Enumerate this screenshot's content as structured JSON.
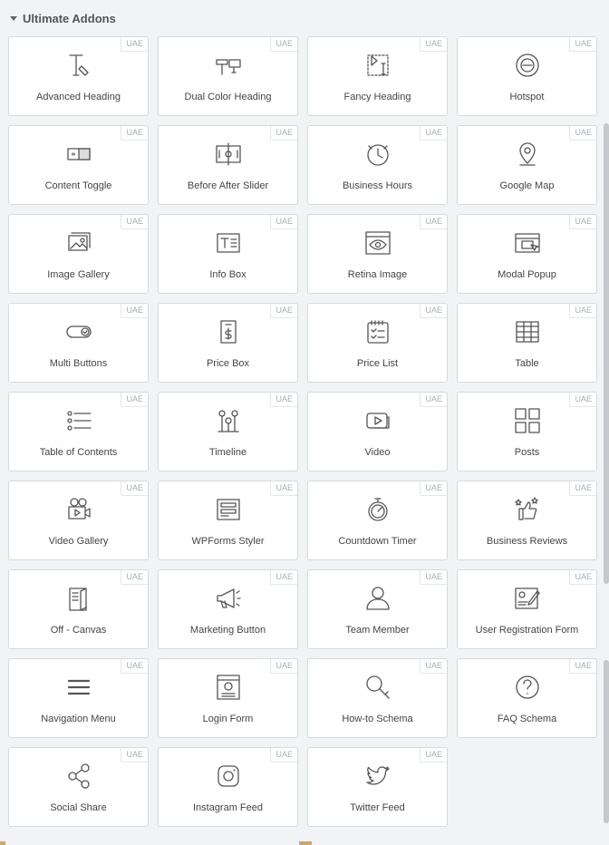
{
  "section": {
    "title": "Ultimate Addons"
  },
  "badge": "UAE",
  "widgets": [
    {
      "label": "Advanced Heading",
      "icon": "advanced-heading-icon"
    },
    {
      "label": "Dual Color Heading",
      "icon": "dual-color-heading-icon"
    },
    {
      "label": "Fancy Heading",
      "icon": "fancy-heading-icon"
    },
    {
      "label": "Hotspot",
      "icon": "hotspot-icon"
    },
    {
      "label": "Content Toggle",
      "icon": "content-toggle-icon"
    },
    {
      "label": "Before After Slider",
      "icon": "before-after-slider-icon"
    },
    {
      "label": "Business Hours",
      "icon": "business-hours-icon"
    },
    {
      "label": "Google Map",
      "icon": "map-pin-icon"
    },
    {
      "label": "Image Gallery",
      "icon": "image-gallery-icon"
    },
    {
      "label": "Info Box",
      "icon": "info-box-icon"
    },
    {
      "label": "Retina Image",
      "icon": "retina-image-icon"
    },
    {
      "label": "Modal Popup",
      "icon": "modal-popup-icon"
    },
    {
      "label": "Multi Buttons",
      "icon": "multi-buttons-icon"
    },
    {
      "label": "Price Box",
      "icon": "price-box-icon"
    },
    {
      "label": "Price List",
      "icon": "price-list-icon"
    },
    {
      "label": "Table",
      "icon": "table-icon"
    },
    {
      "label": "Table of Contents",
      "icon": "table-of-contents-icon"
    },
    {
      "label": "Timeline",
      "icon": "timeline-icon"
    },
    {
      "label": "Video",
      "icon": "video-icon"
    },
    {
      "label": "Posts",
      "icon": "posts-icon"
    },
    {
      "label": "Video Gallery",
      "icon": "video-gallery-icon"
    },
    {
      "label": "WPForms Styler",
      "icon": "wpforms-styler-icon"
    },
    {
      "label": "Countdown Timer",
      "icon": "stopwatch-icon"
    },
    {
      "label": "Business Reviews",
      "icon": "thumbs-up-icon"
    },
    {
      "label": "Off - Canvas",
      "icon": "off-canvas-icon"
    },
    {
      "label": "Marketing Button",
      "icon": "megaphone-icon"
    },
    {
      "label": "Team Member",
      "icon": "user-icon"
    },
    {
      "label": "User Registration Form",
      "icon": "registration-form-icon"
    },
    {
      "label": "Navigation Menu",
      "icon": "hamburger-menu-icon"
    },
    {
      "label": "Login Form",
      "icon": "login-form-icon"
    },
    {
      "label": "How-to Schema",
      "icon": "magnifier-icon"
    },
    {
      "label": "FAQ Schema",
      "icon": "question-icon"
    },
    {
      "label": "Social Share",
      "icon": "share-icon"
    },
    {
      "label": "Instagram Feed",
      "icon": "instagram-icon"
    },
    {
      "label": "Twitter Feed",
      "icon": "twitter-icon"
    }
  ]
}
